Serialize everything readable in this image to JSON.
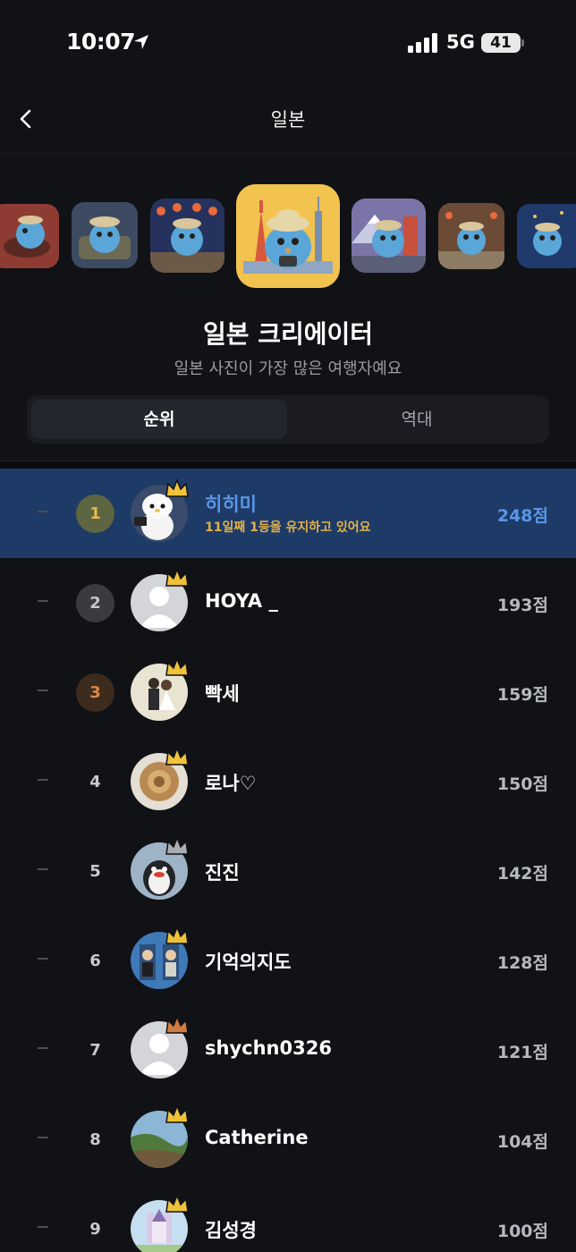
{
  "status_bar": {
    "time": "10:07",
    "network": "5G",
    "battery": "41"
  },
  "nav": {
    "title": "일본",
    "back_icon": "chevron-left-icon"
  },
  "badges": {
    "selected_label": "일본 크리에이터",
    "selected_description": "일본 사진이 가장 많은 여행자예요",
    "items": [
      "ramen-bird-badge",
      "explorer-bird-badge",
      "lantern-festival-badge",
      "tokyo-tower-badge",
      "mount-fuji-badge",
      "old-street-badge",
      "night-bird-badge"
    ]
  },
  "tabs": {
    "ranking": "순위",
    "all_time": "역대"
  },
  "ranking": [
    {
      "rank": "1",
      "change": "–",
      "name": "히히미",
      "note": "11일째 1등을 유지하고 있어요",
      "score": "248점"
    },
    {
      "rank": "2",
      "change": "–",
      "name": "HOYA _",
      "score": "193점"
    },
    {
      "rank": "3",
      "change": "–",
      "name": "빡세",
      "score": "159점"
    },
    {
      "rank": "4",
      "change": "–",
      "name": "로나♡",
      "score": "150점"
    },
    {
      "rank": "5",
      "change": "–",
      "name": "진진",
      "score": "142점"
    },
    {
      "rank": "6",
      "change": "–",
      "name": "기억의지도",
      "score": "128점"
    },
    {
      "rank": "7",
      "change": "–",
      "name": "shychn0326",
      "score": "121점"
    },
    {
      "rank": "8",
      "change": "–",
      "name": "Catherine",
      "score": "104점"
    },
    {
      "rank": "9",
      "change": "–",
      "name": "김성경",
      "score": "100점"
    }
  ],
  "colors": {
    "background": "#111216",
    "highlight_row": "#1e3a66",
    "accent_blue": "#5a97e8",
    "gold": "#e3b84e",
    "crown_gold": "#f0c23a",
    "crown_silver": "#a9adb4",
    "crown_bronze": "#d17c3f"
  }
}
